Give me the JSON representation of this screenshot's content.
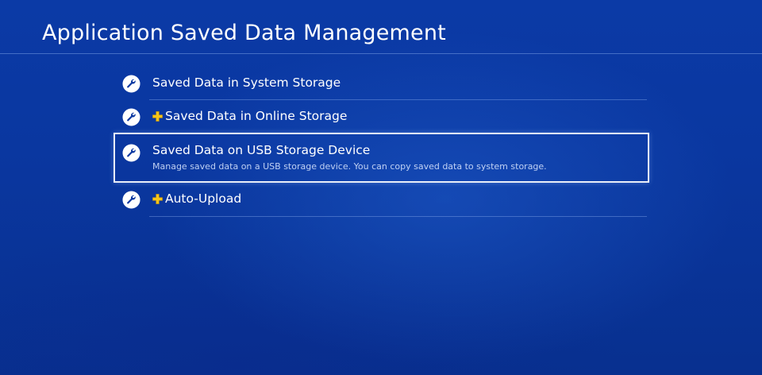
{
  "header": {
    "title": "Application Saved Data Management"
  },
  "menu": {
    "items": [
      {
        "label": "Saved Data in System Storage",
        "icon": "wrench-icon",
        "plus_badge": false
      },
      {
        "label": "Saved Data in Online Storage",
        "icon": "wrench-icon",
        "plus_badge": true
      },
      {
        "label": "Saved Data on USB Storage Device",
        "description": "Manage saved data on a USB storage device. You can copy saved data to system storage.",
        "icon": "wrench-icon",
        "plus_badge": false,
        "selected": true
      },
      {
        "label": "Auto-Upload",
        "icon": "wrench-icon",
        "plus_badge": true
      }
    ]
  },
  "colors": {
    "background": "#0a37a0",
    "text": "#ffffff",
    "plus_badge": "#f5c518",
    "selection_border": "#e9eef8"
  }
}
